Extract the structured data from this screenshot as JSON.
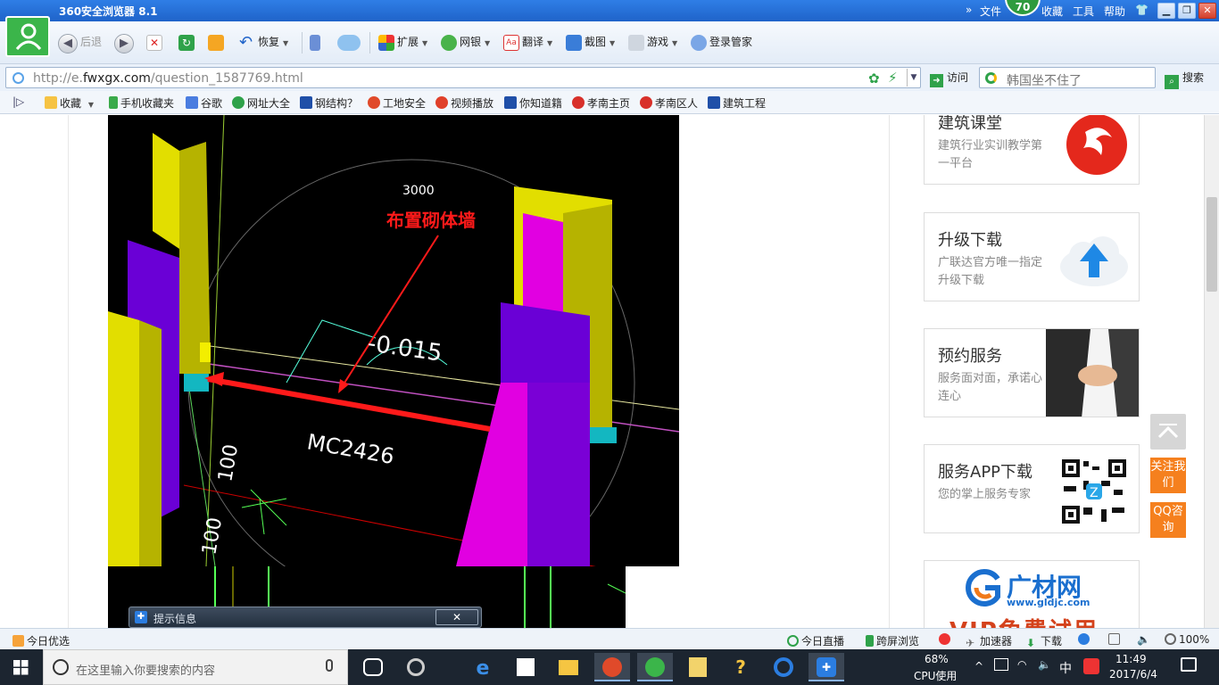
{
  "browser": {
    "title": "360安全浏览器 8.1",
    "menu": [
      "文件",
      "收藏",
      "工具",
      "帮助"
    ],
    "badge": "70"
  },
  "toolbar": {
    "back": "后退",
    "restore": "恢复",
    "expand": "扩展",
    "bank": "网银",
    "translate": "翻译",
    "screenshot": "截图",
    "games": "游戏",
    "login": "登录管家"
  },
  "address": {
    "url_prefix": "http://e.",
    "url_domain": "fwxgx.com",
    "url_path": "/question_1587769.html",
    "visit": "访问",
    "search_placeholder": "韩国坐不住了",
    "search_button": "搜索"
  },
  "favorites": [
    "收藏",
    "手机收藏夹",
    "谷歌",
    "网址大全",
    "钢结构？",
    "工地安全",
    "视频播放",
    "你知道籍",
    "孝南主页",
    "孝南区人",
    "建筑工程"
  ],
  "cad": {
    "dim_top": "3000",
    "annotation": "布置砌体墙",
    "elevation": "-0.015",
    "door_label": "MC2426",
    "dim_a": "100",
    "dim_b": "100"
  },
  "sidebar": {
    "cards": [
      {
        "title": "建筑课堂",
        "desc": "建筑行业实训教学第一平台"
      },
      {
        "title": "升级下载",
        "desc": "广联达官方唯一指定升级下载"
      },
      {
        "title": "预约服务",
        "desc": "服务面对面，承诺心连心"
      },
      {
        "title": "服务APP下载",
        "desc": "您的掌上服务专家"
      }
    ],
    "brand": "广材网",
    "brand_url": "www.gldjc.com",
    "brand_promo": "VIP免费试用",
    "follow": "关注我们",
    "qq": "QQ咨询"
  },
  "tip": {
    "title": "提示信息",
    "close": "✕"
  },
  "status": {
    "today_pick": "今日优选",
    "live": "今日直播",
    "cross_screen": "跨屏浏览",
    "accelerator": "加速器",
    "download": "下载",
    "zoom": "100%"
  },
  "taskbar": {
    "search_placeholder": "在这里输入你要搜索的内容",
    "cpu_percent": "68%",
    "cpu_label": "CPU使用",
    "ime": "中",
    "time": "11:49",
    "date": "2017/6/4"
  },
  "colors": {
    "accent": "#1f63c9",
    "orange": "#f5801e",
    "cad_yellow": "#e2de00",
    "cad_purple": "#6a00d6",
    "cad_magenta": "#e100e1",
    "annotation_red": "#ff1a1a"
  }
}
